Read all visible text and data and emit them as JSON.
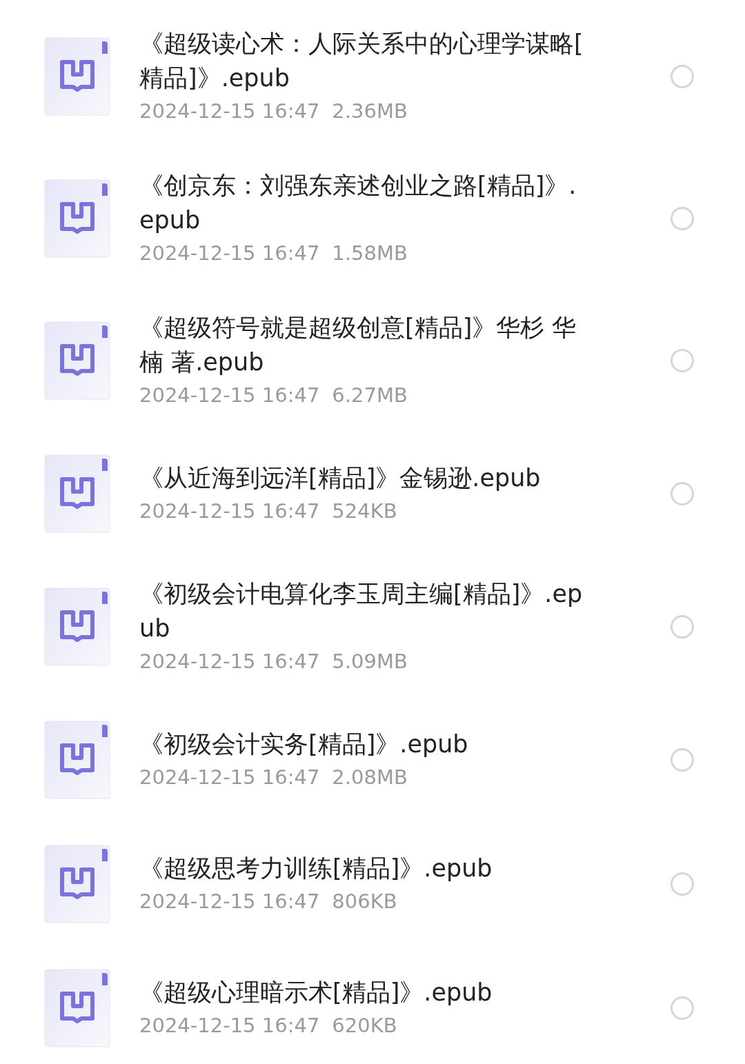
{
  "files": [
    {
      "name": "《超级读心术：人际关系中的心理学谋略[精品]》.epub",
      "date": "2024-12-15 16:47",
      "size": "2.36MB",
      "selected": false
    },
    {
      "name": "《创京东：刘强东亲述创业之路[精品]》.epub",
      "date": "2024-12-15 16:47",
      "size": "1.58MB",
      "selected": false
    },
    {
      "name": "《超级符号就是超级创意[精品]》华杉 华楠 著.epub",
      "date": "2024-12-15 16:47",
      "size": "6.27MB",
      "selected": false
    },
    {
      "name": "《从近海到远洋[精品]》金锡逊.epub",
      "date": "2024-12-15 16:47",
      "size": "524KB",
      "selected": false
    },
    {
      "name": "《初级会计电算化李玉周主编[精品]》.epub",
      "date": "2024-12-15 16:47",
      "size": "5.09MB",
      "selected": false
    },
    {
      "name": "《初级会计实务[精品]》.epub",
      "date": "2024-12-15 16:47",
      "size": "2.08MB",
      "selected": false
    },
    {
      "name": "《超级思考力训练[精品]》.epub",
      "date": "2024-12-15 16:47",
      "size": "806KB",
      "selected": false
    },
    {
      "name": "《超级心理暗示术[精品]》.epub",
      "date": "2024-12-15 16:47",
      "size": "620KB",
      "selected": false
    }
  ]
}
